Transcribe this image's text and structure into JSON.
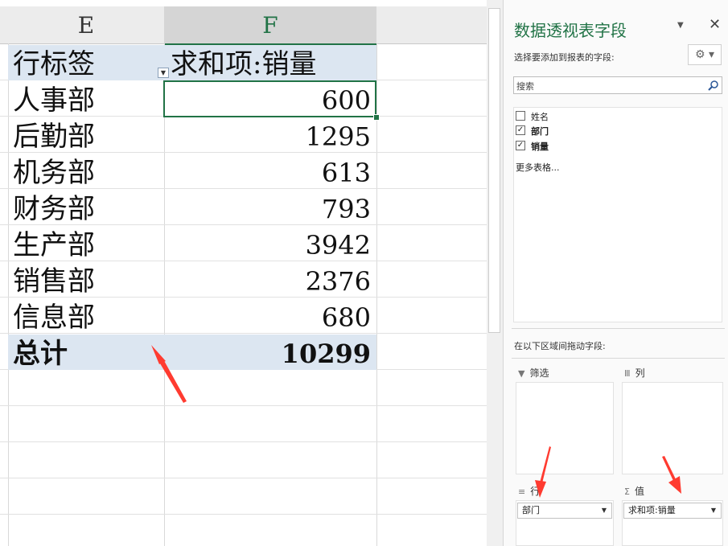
{
  "columns": [
    "E",
    "F"
  ],
  "pivot": {
    "header": {
      "row_label": "行标签",
      "value_label": "求和项:销量"
    },
    "rows": [
      {
        "label": "人事部",
        "value": "600"
      },
      {
        "label": "后勤部",
        "value": "1295"
      },
      {
        "label": "机务部",
        "value": "613"
      },
      {
        "label": "财务部",
        "value": "793"
      },
      {
        "label": "生产部",
        "value": "3942"
      },
      {
        "label": "销售部",
        "value": "2376"
      },
      {
        "label": "信息部",
        "value": "680"
      }
    ],
    "total": {
      "label": "总计",
      "value": "10299"
    }
  },
  "field_pane": {
    "title": "数据透视表字段",
    "choose_label": "选择要添加到报表的字段:",
    "search_placeholder": "搜索",
    "fields": [
      {
        "name": "姓名",
        "checked": false,
        "check": ""
      },
      {
        "name": "部门",
        "checked": true,
        "check": "✓"
      },
      {
        "name": "销量",
        "checked": true,
        "check": "✓"
      }
    ],
    "more_tables": "更多表格...",
    "drag_label": "在以下区域间拖动字段:",
    "areas": {
      "filters": {
        "label": "筛选",
        "icon": "▼"
      },
      "columns": {
        "label": "列",
        "icon": "Ⅲ"
      },
      "rows": {
        "label": "行",
        "icon": "≡",
        "item": "部门"
      },
      "values": {
        "label": "值",
        "icon": "Σ",
        "item": "求和项:销量"
      }
    }
  },
  "colors": {
    "accent": "#217346",
    "pivot_band": "#dce6f1",
    "annotation": "#ff3b30"
  }
}
